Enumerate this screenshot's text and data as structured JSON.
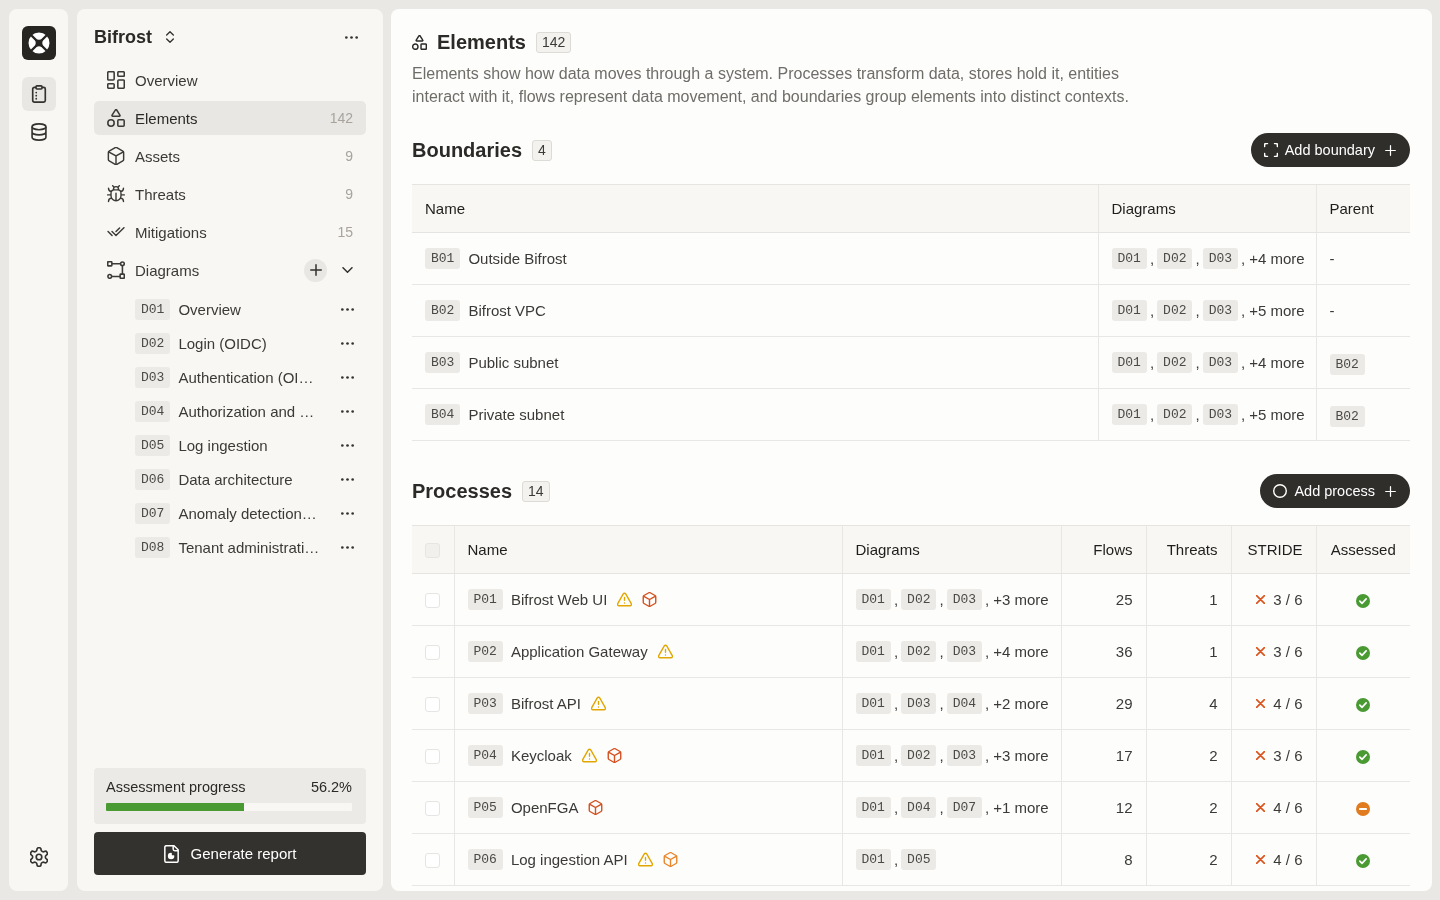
{
  "rail": {
    "items": [
      {
        "kind": "clipboard",
        "selected": true
      },
      {
        "kind": "database",
        "selected": false
      }
    ]
  },
  "sidebar": {
    "project": "Bifrost",
    "nav": [
      {
        "kind": "overview",
        "label": "Overview",
        "selected": false
      },
      {
        "kind": "elements",
        "label": "Elements",
        "count": "142",
        "selected": true
      },
      {
        "kind": "assets",
        "label": "Assets",
        "count": "9",
        "selected": false
      },
      {
        "kind": "threats",
        "label": "Threats",
        "count": "9",
        "selected": false
      },
      {
        "kind": "mitigations",
        "label": "Mitigations",
        "count": "15",
        "selected": false
      },
      {
        "kind": "diagrams",
        "label": "Diagrams",
        "selected": false,
        "expanded": true,
        "children": [
          {
            "code": "D01",
            "title": "Overview"
          },
          {
            "code": "D02",
            "title": "Login (OIDC)"
          },
          {
            "code": "D03",
            "title": "Authentication (OI…"
          },
          {
            "code": "D04",
            "title": "Authorization and …"
          },
          {
            "code": "D05",
            "title": "Log ingestion"
          },
          {
            "code": "D06",
            "title": "Data architecture"
          },
          {
            "code": "D07",
            "title": "Anomaly detection…"
          },
          {
            "code": "D08",
            "title": "Tenant administrati…"
          }
        ]
      }
    ],
    "progress": {
      "label": "Assessment progress",
      "reading": "56.2%",
      "level": 0.562
    },
    "report_button": "Generate report"
  },
  "main": {
    "title": "Elements",
    "count": "142",
    "description": "Elements show how data moves through a system. Processes transform data, stores hold it, entities interact with it, flows represent data movement, and boundaries group elements into distinct contexts.",
    "list_separator": ",",
    "boundaries": {
      "title": "Boundaries",
      "count": "4",
      "button": "Add boundary",
      "columns": [
        "Name",
        "Diagrams",
        "Parent"
      ],
      "rows": [
        {
          "code": "B01",
          "name": "Outside Bifrost",
          "diagrams": [
            "D01",
            "D02",
            "D03"
          ],
          "more": "+4 more",
          "parent": {
            "kind": "text",
            "text": "-"
          }
        },
        {
          "code": "B02",
          "name": "Bifrost VPC",
          "diagrams": [
            "D01",
            "D02",
            "D03"
          ],
          "more": "+5 more",
          "parent": {
            "kind": "text",
            "text": "-"
          }
        },
        {
          "code": "B03",
          "name": "Public subnet",
          "diagrams": [
            "D01",
            "D02",
            "D03"
          ],
          "more": "+4 more",
          "parent": {
            "kind": "ref",
            "text": "B02"
          }
        },
        {
          "code": "B04",
          "name": "Private subnet",
          "diagrams": [
            "D01",
            "D02",
            "D03"
          ],
          "more": "+5 more",
          "parent": {
            "kind": "ref",
            "text": "B02"
          }
        }
      ]
    },
    "processes": {
      "title": "Processes",
      "count": "14",
      "button": "Add process",
      "select_all": {
        "checked": false
      },
      "columns": [
        "Name",
        "Diagrams",
        "Flows",
        "Threats",
        "STRIDE",
        "Assessed"
      ],
      "rows": [
        {
          "checked": false,
          "code": "P01",
          "name": "Bifrost Web UI",
          "warning": true,
          "asset": {
            "color": "#d4501f"
          },
          "diagrams": [
            "D01",
            "D02",
            "D03"
          ],
          "more": "+3 more",
          "flows": "25",
          "threats": "1",
          "stride": "3 / 6",
          "assessed": true
        },
        {
          "checked": false,
          "code": "P02",
          "name": "Application Gateway",
          "warning": true,
          "diagrams": [
            "D01",
            "D02",
            "D03"
          ],
          "more": "+4 more",
          "flows": "36",
          "threats": "1",
          "stride": "3 / 6",
          "assessed": true
        },
        {
          "checked": false,
          "code": "P03",
          "name": "Bifrost API",
          "warning": true,
          "diagrams": [
            "D01",
            "D03",
            "D04"
          ],
          "more": "+2 more",
          "flows": "29",
          "threats": "4",
          "stride": "4 / 6",
          "assessed": true
        },
        {
          "checked": false,
          "code": "P04",
          "name": "Keycloak",
          "warning": true,
          "asset": {
            "color": "#d4501f"
          },
          "diagrams": [
            "D01",
            "D02",
            "D03"
          ],
          "more": "+3 more",
          "flows": "17",
          "threats": "2",
          "stride": "3 / 6",
          "assessed": true
        },
        {
          "checked": false,
          "code": "P05",
          "name": "OpenFGA",
          "warning": false,
          "asset": {
            "color": "#d4501f"
          },
          "diagrams": [
            "D01",
            "D04",
            "D07"
          ],
          "more": "+1 more",
          "flows": "12",
          "threats": "2",
          "stride": "4 / 6",
          "assessed": false
        },
        {
          "checked": false,
          "code": "P06",
          "name": "Log ingestion API",
          "warning": true,
          "asset": {
            "color": "#e8862a"
          },
          "diagrams": [
            "D01",
            "D05"
          ],
          "flows": "8",
          "threats": "2",
          "stride": "4 / 6",
          "assessed": true
        }
      ]
    }
  }
}
